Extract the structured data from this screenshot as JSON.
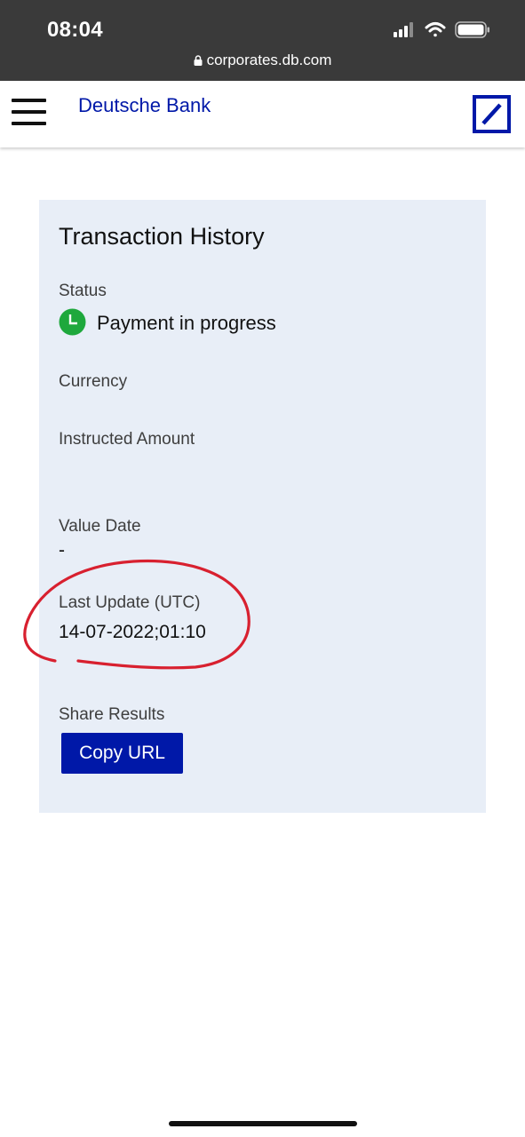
{
  "status_bar": {
    "time": "08:04",
    "url": "corporates.db.com",
    "icons": [
      "signal-icon",
      "wifi-icon",
      "battery-icon",
      "lock-icon"
    ]
  },
  "header": {
    "brand": "Deutsche Bank",
    "brand_color": "#0018a8",
    "icons": [
      "menu-icon",
      "deutsche-bank-logo"
    ]
  },
  "card": {
    "title": "Transaction History",
    "background": "#e8eef7",
    "status": {
      "label": "Status",
      "value": "Payment in progress",
      "icon": "clock-icon",
      "icon_color": "#1ea83c"
    },
    "currency": {
      "label": "Currency",
      "value": ""
    },
    "instructed_amount": {
      "label": "Instructed Amount",
      "value": ""
    },
    "value_date": {
      "label": "Value Date",
      "value": "-"
    },
    "last_update": {
      "label": "Last Update (UTC)",
      "value": "14-07-2022;01:10"
    },
    "share": {
      "label": "Share Results",
      "button": "Copy URL"
    }
  },
  "annotation": {
    "type": "hand-drawn-circle",
    "color": "#d8202f"
  }
}
